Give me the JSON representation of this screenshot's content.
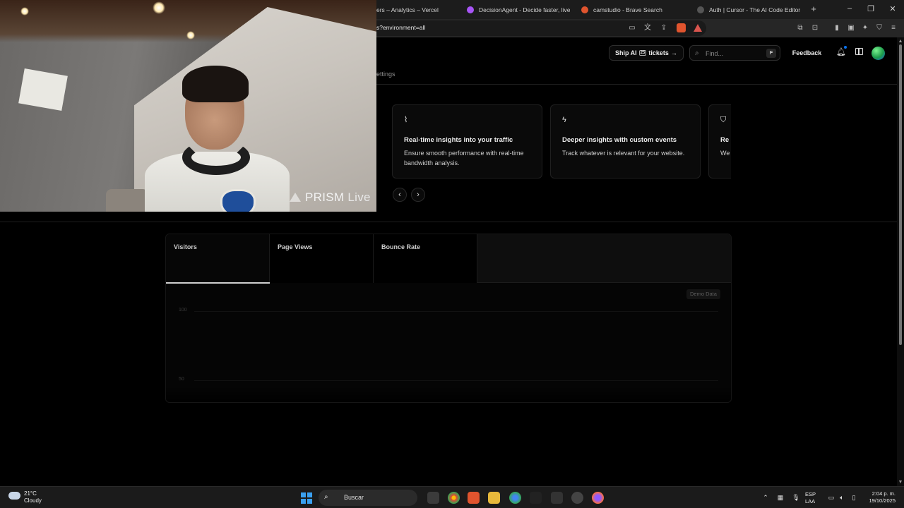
{
  "browser": {
    "tabs": [
      {
        "title": "ers – Analytics – Vercel",
        "favicon_color": "#000000"
      },
      {
        "title": "DecisionAgent - Decide faster, live li",
        "favicon_color": "#8b5cf6"
      },
      {
        "title": "camstudio - Brave Search",
        "favicon_color": "#e0542e"
      },
      {
        "title": "Auth | Cursor - The AI Code Editor",
        "favicon_color": "#222222"
      }
    ],
    "new_tab": "+",
    "url": "s?environment=all"
  },
  "header": {
    "ship_label": "Ship AI",
    "ship_chip": "25",
    "ship_suffix": "tickets",
    "ship_arrow": "→",
    "find_placeholder": "Find...",
    "find_shortcut": "F",
    "feedback_label": "Feedback"
  },
  "nav": {
    "settings_tab": "ettings"
  },
  "features": [
    {
      "icon": "chart-line-icon",
      "glyph": "⌇",
      "title": "Real-time insights into your traffic",
      "description": "Ensure smooth performance with real-time bandwidth analysis."
    },
    {
      "icon": "bolt-icon",
      "glyph": "ϟ",
      "title": "Deeper insights with custom events",
      "description": "Track whatever is relevant for your website."
    },
    {
      "icon": "shield-icon",
      "glyph": "⛉",
      "title": "Re",
      "description": "We and"
    }
  ],
  "carousel": {
    "prev": "‹",
    "next": "›"
  },
  "analytics": {
    "tabs": [
      {
        "label": "Visitors",
        "active": true
      },
      {
        "label": "Page Views",
        "active": false
      },
      {
        "label": "Bounce Rate",
        "active": false
      }
    ],
    "badge": "Demo Data",
    "y_ticks": [
      "100",
      "50"
    ]
  },
  "webcam": {
    "brand": "PRISM",
    "brand_suffix": "Live"
  },
  "taskbar": {
    "weather_temp": "21°C",
    "weather_desc": "Cloudy",
    "search_label": "Buscar",
    "lang_top": "ESP",
    "lang_bottom": "LAA",
    "time": "2:04 p. m.",
    "date": "19/10/2025"
  }
}
